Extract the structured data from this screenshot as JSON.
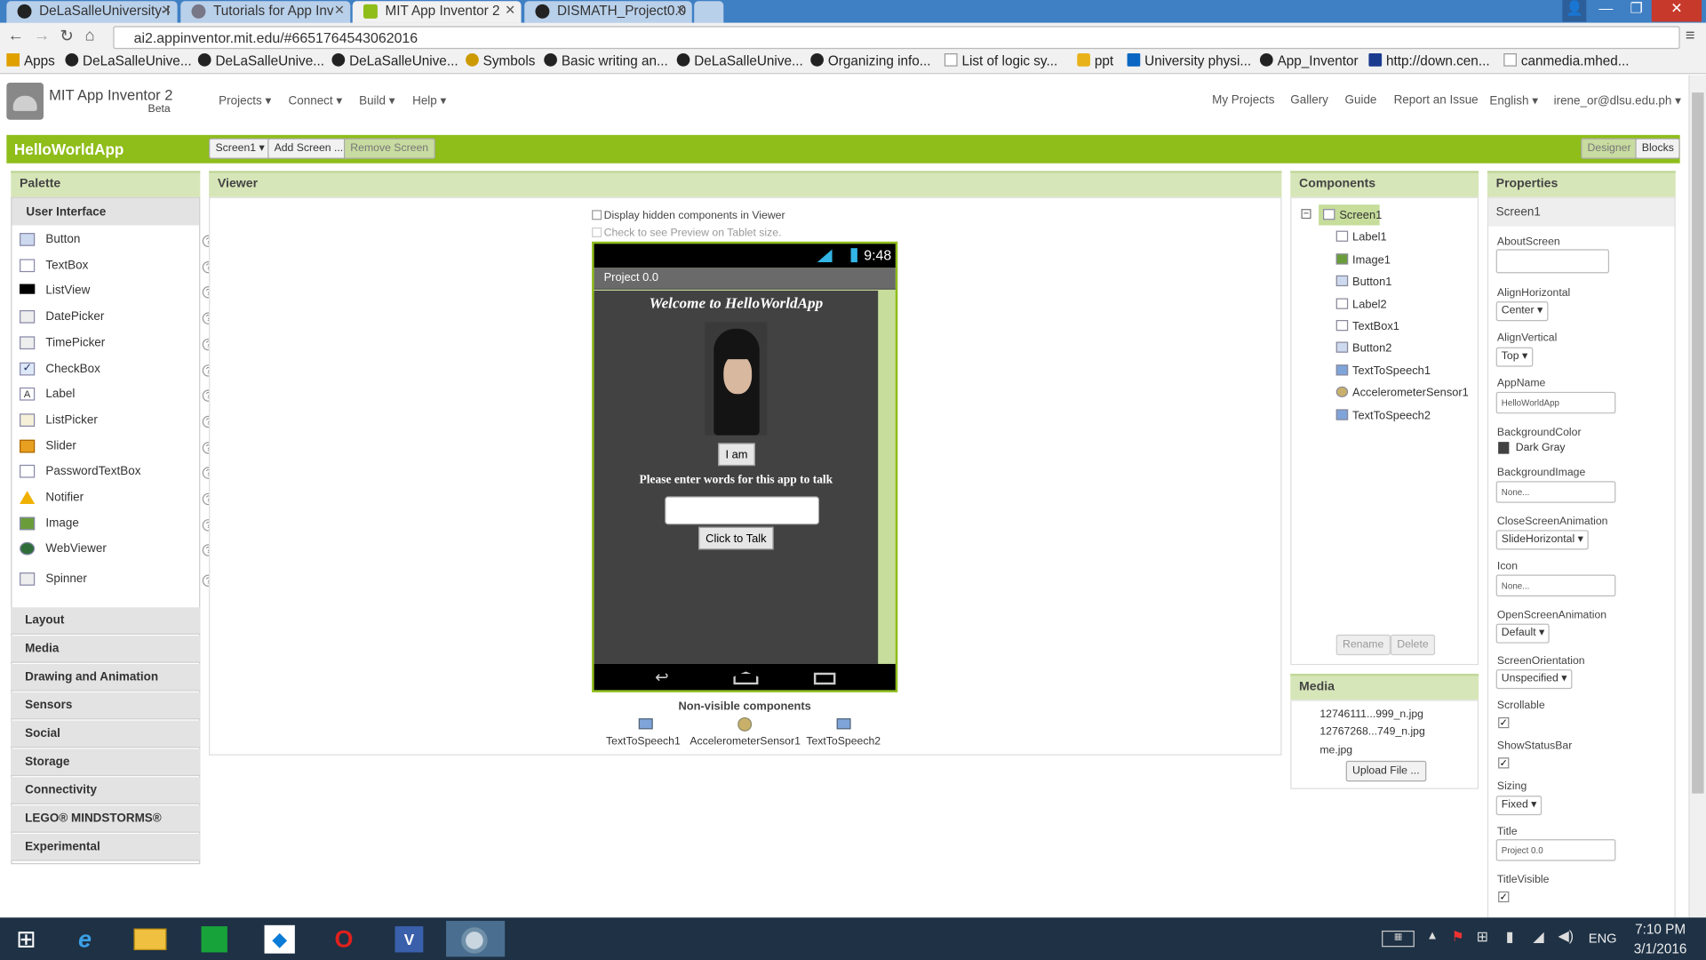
{
  "browser": {
    "tabs": [
      {
        "title": "DeLaSalleUniversity-I"
      },
      {
        "title": "Tutorials for App Inv"
      },
      {
        "title": "MIT App Inventor 2"
      },
      {
        "title": "DISMATH_Project0.0"
      }
    ],
    "url": "ai2.appinventor.mit.edu/#6651764543062016",
    "bookmarks": [
      "Apps",
      "DeLaSalleUnive...",
      "DeLaSalleUnive...",
      "DeLaSalleUnive...",
      "Symbols",
      "Basic writing an...",
      "DeLaSalleUnive...",
      "Organizing info...",
      "List of logic sy...",
      "ppt",
      "University physi...",
      "App_Inventor",
      "http://down.cen...",
      "canmedia.mhed..."
    ]
  },
  "app": {
    "brand": "MIT App Inventor 2",
    "brand_sub": "Beta",
    "menus": [
      "Projects ▾",
      "Connect ▾",
      "Build ▾",
      "Help ▾"
    ],
    "right_links": [
      "My Projects",
      "Gallery",
      "Guide",
      "Report an Issue",
      "English ▾",
      "irene_or@dlsu.edu.ph ▾"
    ],
    "project_name": "HelloWorldApp",
    "screen_select": "Screen1 ▾",
    "add_screen": "Add Screen ...",
    "remove_screen": "Remove Screen",
    "designer": "Designer",
    "blocks": "Blocks"
  },
  "palette": {
    "title": "Palette",
    "category_open": "User Interface",
    "items": [
      "Button",
      "TextBox",
      "ListView",
      "DatePicker",
      "TimePicker",
      "CheckBox",
      "Label",
      "ListPicker",
      "Slider",
      "PasswordTextBox",
      "Notifier",
      "Image",
      "WebViewer",
      "Spinner"
    ],
    "categories": [
      "Layout",
      "Media",
      "Drawing and Animation",
      "Sensors",
      "Social",
      "Storage",
      "Connectivity",
      "LEGO® MINDSTORMS®",
      "Experimental"
    ]
  },
  "viewer": {
    "title": "Viewer",
    "chk_hidden": "Display hidden components in Viewer",
    "chk_tablet": "Check to see Preview on Tablet size.",
    "phone": {
      "time": "9:48",
      "title": "Project 0.0",
      "welcome": "Welcome to HelloWorldApp",
      "button1": "I am",
      "label2": "Please enter words for this app to talk",
      "button2": "Click to Talk"
    },
    "nonvisible_title": "Non-visible components",
    "nonvisible": [
      "TextToSpeech1",
      "AccelerometerSensor1",
      "TextToSpeech2"
    ]
  },
  "components": {
    "title": "Components",
    "tree": [
      "Screen1",
      "Label1",
      "Image1",
      "Button1",
      "Label2",
      "TextBox1",
      "Button2",
      "TextToSpeech1",
      "AccelerometerSensor1",
      "TextToSpeech2"
    ],
    "rename": "Rename",
    "delete": "Delete"
  },
  "media": {
    "title": "Media",
    "files": [
      "12746111...999_n.jpg",
      "12767268...749_n.jpg",
      "me.jpg"
    ],
    "upload": "Upload File ..."
  },
  "properties": {
    "title": "Properties",
    "screen": "Screen1",
    "about_label": "AboutScreen",
    "alignh_label": "AlignHorizontal",
    "alignh_value": "Center ▾",
    "alignv_label": "AlignVertical",
    "alignv_value": "Top ▾",
    "appname_label": "AppName",
    "appname_value": "HelloWorldApp",
    "bgcolor_label": "BackgroundColor",
    "bgcolor_value": "Dark Gray",
    "bgimage_label": "BackgroundImage",
    "bgimage_value": "None...",
    "closeanim_label": "CloseScreenAnimation",
    "closeanim_value": "SlideHorizontal ▾",
    "icon_label": "Icon",
    "icon_value": "None...",
    "openanim_label": "OpenScreenAnimation",
    "openanim_value": "Default ▾",
    "orient_label": "ScreenOrientation",
    "orient_value": "Unspecified ▾",
    "scrollable_label": "Scrollable",
    "statusbar_label": "ShowStatusBar",
    "sizing_label": "Sizing",
    "sizing_value": "Fixed ▾",
    "title_label": "Title",
    "title_value": "Project 0.0",
    "titlevisible_label": "TitleVisible"
  },
  "taskbar": {
    "lang": "ENG",
    "time": "7:10 PM",
    "date": "3/1/2016"
  },
  "colors": {
    "accent": "#8fbd1a",
    "panel_head": "#d7e6b8",
    "phone_bg": "#424242",
    "taskbar": "#1e3145"
  }
}
